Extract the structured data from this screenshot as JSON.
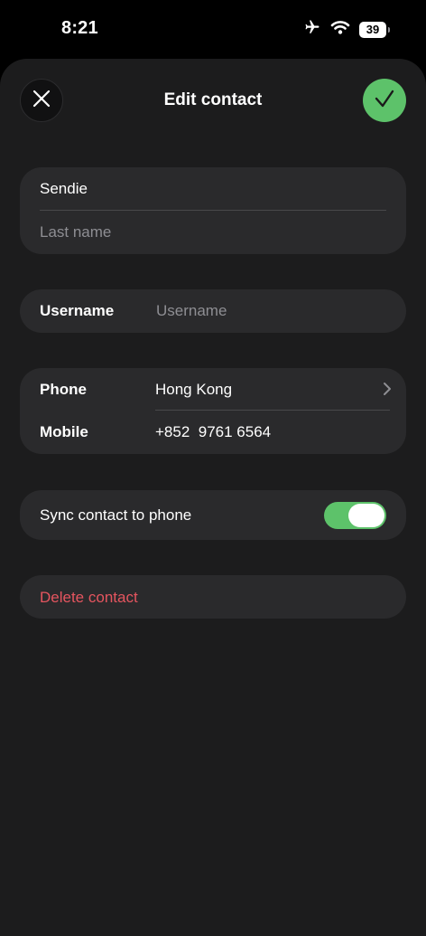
{
  "status_bar": {
    "time": "8:21",
    "battery": "39",
    "icons": [
      "airplane-icon",
      "wifi-icon",
      "battery-icon"
    ]
  },
  "header": {
    "title": "Edit contact",
    "close_icon": "close-icon",
    "done_icon": "checkmark-icon"
  },
  "name": {
    "first_name_value": "Sendie",
    "last_name_placeholder": "Last name"
  },
  "username": {
    "label": "Username",
    "placeholder": "Username"
  },
  "phone": {
    "country_label": "Phone",
    "country_value": "Hong Kong",
    "number_label": "Mobile",
    "number_value": "+852  9761 6564"
  },
  "sync": {
    "label": "Sync contact to phone",
    "enabled": true
  },
  "delete": {
    "label": "Delete contact"
  },
  "colors": {
    "accent_green": "#5dc26a",
    "destructive_red": "#e5555f",
    "card_bg": "#2a2a2c",
    "sheet_bg": "#1c1c1d"
  }
}
